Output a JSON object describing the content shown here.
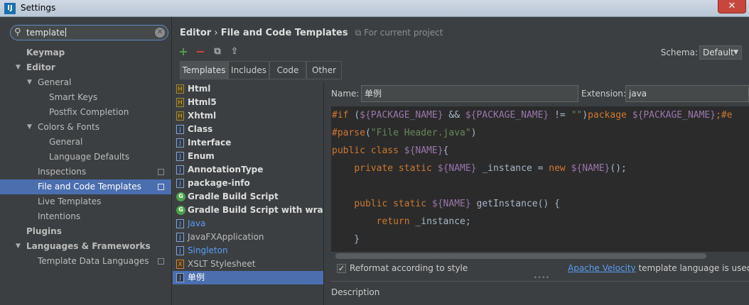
{
  "window": {
    "title": "Settings",
    "icon_text": "IJ",
    "close_label": "✕"
  },
  "search": {
    "value": "template"
  },
  "tree": [
    {
      "label": "Keymap",
      "level": 0,
      "bold": true,
      "arrow": ""
    },
    {
      "label": "Editor",
      "level": 0,
      "bold": true,
      "arrow": "▼"
    },
    {
      "label": "General",
      "level": 1,
      "bold": false,
      "arrow": "▼"
    },
    {
      "label": "Smart Keys",
      "level": 3,
      "bold": false,
      "arrow": ""
    },
    {
      "label": "Postfix Completion",
      "level": 3,
      "bold": false,
      "arrow": ""
    },
    {
      "label": "Colors & Fonts",
      "level": 1,
      "bold": false,
      "arrow": "▼"
    },
    {
      "label": "General",
      "level": 3,
      "bold": false,
      "arrow": ""
    },
    {
      "label": "Language Defaults",
      "level": 3,
      "bold": false,
      "arrow": ""
    },
    {
      "label": "Inspections",
      "level": 2,
      "bold": false,
      "arrow": "",
      "project": true
    },
    {
      "label": "File and Code Templates",
      "level": 2,
      "bold": false,
      "arrow": "",
      "project": true,
      "selected": true
    },
    {
      "label": "Live Templates",
      "level": 2,
      "bold": false,
      "arrow": ""
    },
    {
      "label": "Intentions",
      "level": 2,
      "bold": false,
      "arrow": ""
    },
    {
      "label": "Plugins",
      "level": 0,
      "bold": true,
      "arrow": ""
    },
    {
      "label": "Languages & Frameworks",
      "level": 0,
      "bold": true,
      "arrow": "▼"
    },
    {
      "label": "Template Data Languages",
      "level": 2,
      "bold": false,
      "arrow": "",
      "project": true
    }
  ],
  "breadcrumb": {
    "part1": "Editor",
    "sep": "›",
    "part2": "File and Code Templates",
    "scope": "For current project"
  },
  "schema": {
    "label": "Schema:",
    "value": "Default"
  },
  "tabs": [
    "Templates",
    "Includes",
    "Code",
    "Other"
  ],
  "templates": [
    {
      "name": "Html",
      "icon": "html",
      "style": "bold"
    },
    {
      "name": "Html5",
      "icon": "html",
      "style": "bold"
    },
    {
      "name": "Xhtml",
      "icon": "html",
      "style": "bold"
    },
    {
      "name": "Class",
      "icon": "java",
      "style": "bold"
    },
    {
      "name": "Interface",
      "icon": "java",
      "style": "bold"
    },
    {
      "name": "Enum",
      "icon": "java",
      "style": "bold"
    },
    {
      "name": "AnnotationType",
      "icon": "java",
      "style": "bold"
    },
    {
      "name": "package-info",
      "icon": "java",
      "style": "bold"
    },
    {
      "name": "Gradle Build Script",
      "icon": "gradle",
      "style": "bold"
    },
    {
      "name": "Gradle Build Script with wrappe",
      "icon": "gradle",
      "style": "bold"
    },
    {
      "name": "Java",
      "icon": "java",
      "style": "link"
    },
    {
      "name": "JavaFXApplication",
      "icon": "java",
      "style": "normal"
    },
    {
      "name": "Singleton",
      "icon": "java",
      "style": "link"
    },
    {
      "name": "XSLT Stylesheet",
      "icon": "xslt",
      "style": "normal"
    },
    {
      "name": "单例",
      "icon": "java",
      "style": "selected"
    }
  ],
  "editor": {
    "name_label": "Name:",
    "name_value": "单例",
    "ext_label": "Extension:",
    "ext_value": "java",
    "code_lines": [
      [
        [
          "dir",
          "#if "
        ],
        [
          "plain",
          "("
        ],
        [
          "var",
          "${PACKAGE_NAME}"
        ],
        [
          "plain",
          " && "
        ],
        [
          "var",
          "${PACKAGE_NAME}"
        ],
        [
          "plain",
          " != "
        ],
        [
          "str",
          "\"\""
        ],
        [
          "plain",
          ")"
        ],
        [
          "kw",
          "package "
        ],
        [
          "var",
          "${PACKAGE_NAME}"
        ],
        [
          "kw",
          ";#e"
        ]
      ],
      [
        [
          "dir",
          "#parse"
        ],
        [
          "plain",
          "("
        ],
        [
          "str",
          "\"File Header.java\""
        ],
        [
          "plain",
          ")"
        ]
      ],
      [
        [
          "kw",
          "public class "
        ],
        [
          "var",
          "${NAME}"
        ],
        [
          "plain",
          "{"
        ]
      ],
      [
        [
          "plain",
          "    "
        ],
        [
          "kw",
          "private static "
        ],
        [
          "var",
          "${NAME}"
        ],
        [
          "plain",
          " _instance = "
        ],
        [
          "kw",
          "new "
        ],
        [
          "var",
          "${NAME}"
        ],
        [
          "plain",
          "();"
        ]
      ],
      [
        [
          "plain",
          ""
        ]
      ],
      [
        [
          "plain",
          "    "
        ],
        [
          "kw",
          "public static "
        ],
        [
          "var",
          "${NAME}"
        ],
        [
          "plain",
          " getInstance() {"
        ]
      ],
      [
        [
          "plain",
          "        "
        ],
        [
          "kw",
          "return "
        ],
        [
          "plain",
          "_instance;"
        ]
      ],
      [
        [
          "plain",
          "    }"
        ]
      ]
    ],
    "reformat_label": "Reformat according to style",
    "reformat_checked": "✓",
    "velocity_link": "Apache Velocity",
    "velocity_rest": " template language is used",
    "description_label": "Description"
  },
  "toolbar": {
    "add": "+",
    "remove": "−",
    "copy": "⧉",
    "export": "⇪"
  }
}
